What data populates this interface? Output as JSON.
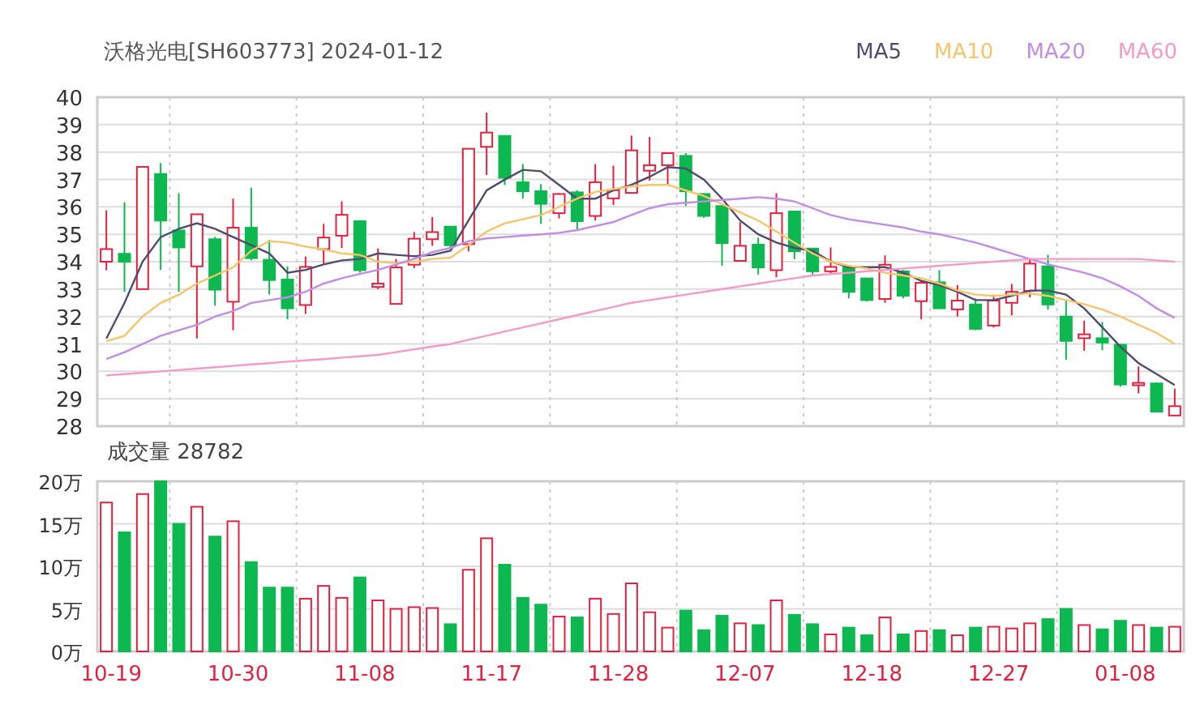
{
  "title": "沃格光电[SH603773] 2024-01-12",
  "price_chart": {
    "chart_data": {
      "type": "candlestick",
      "grid": true,
      "ylim": [
        28,
        40
      ],
      "yticks": [
        28,
        29,
        30,
        31,
        32,
        33,
        34,
        35,
        36,
        37,
        38,
        39,
        40
      ],
      "categories": [
        null,
        null,
        null,
        null,
        null,
        null,
        null,
        null,
        null,
        null,
        null,
        null,
        null,
        null,
        null,
        null,
        null,
        null,
        null,
        null,
        null,
        null,
        null,
        null,
        null,
        null,
        null,
        null,
        null,
        null,
        null,
        null,
        null,
        null,
        null,
        null,
        null,
        null,
        null,
        null,
        null,
        null,
        null,
        null,
        null,
        null,
        null,
        null,
        null,
        null,
        null,
        null,
        null,
        null,
        null,
        null,
        null,
        null,
        null,
        null
      ],
      "ohlc": [
        [
          34.0,
          35.87,
          33.69,
          34.46
        ],
        [
          34.29,
          36.17,
          32.9,
          34.0
        ],
        [
          33.0,
          37.46,
          33.0,
          37.46
        ],
        [
          37.2,
          37.6,
          33.7,
          35.5
        ],
        [
          35.14,
          36.5,
          32.9,
          34.52
        ],
        [
          33.83,
          35.73,
          31.2,
          35.73
        ],
        [
          34.82,
          34.9,
          32.4,
          32.98
        ],
        [
          32.54,
          36.3,
          31.5,
          35.24
        ],
        [
          35.24,
          36.7,
          34.05,
          34.13
        ],
        [
          34.07,
          34.8,
          32.8,
          33.33
        ],
        [
          33.35,
          33.83,
          31.9,
          32.3
        ],
        [
          32.42,
          34.19,
          32.1,
          33.81
        ],
        [
          34.46,
          35.38,
          33.93,
          34.88
        ],
        [
          34.95,
          36.2,
          34.5,
          35.71
        ],
        [
          35.48,
          35.5,
          33.6,
          33.69
        ],
        [
          33.08,
          34.48,
          33.0,
          33.2
        ],
        [
          32.46,
          34.1,
          32.46,
          33.79
        ],
        [
          33.89,
          35.08,
          33.77,
          34.84
        ],
        [
          34.82,
          35.63,
          34.58,
          35.08
        ],
        [
          35.28,
          35.3,
          34.46,
          34.6
        ],
        [
          34.64,
          38.12,
          34.38,
          38.12
        ],
        [
          38.19,
          39.44,
          37.16,
          38.71
        ],
        [
          38.59,
          38.6,
          36.8,
          37.06
        ],
        [
          36.9,
          37.56,
          36.3,
          36.57
        ],
        [
          36.57,
          36.83,
          35.38,
          36.11
        ],
        [
          35.77,
          36.5,
          35.58,
          36.47
        ],
        [
          36.53,
          36.6,
          35.18,
          35.48
        ],
        [
          35.67,
          37.56,
          35.5,
          36.9
        ],
        [
          36.31,
          37.5,
          36.07,
          36.61
        ],
        [
          36.51,
          38.6,
          36.5,
          38.06
        ],
        [
          37.32,
          38.55,
          36.96,
          37.52
        ],
        [
          37.52,
          37.96,
          36.8,
          37.96
        ],
        [
          37.86,
          37.96,
          36.03,
          36.57
        ],
        [
          36.47,
          36.5,
          35.6,
          35.67
        ],
        [
          36.03,
          36.05,
          33.85,
          34.68
        ],
        [
          34.03,
          35.44,
          34.03,
          34.58
        ],
        [
          34.62,
          34.88,
          33.53,
          33.79
        ],
        [
          33.69,
          36.5,
          33.43,
          35.77
        ],
        [
          35.83,
          35.83,
          34.09,
          34.38
        ],
        [
          34.48,
          34.5,
          33.53,
          33.65
        ],
        [
          33.65,
          34.52,
          33.53,
          33.81
        ],
        [
          33.81,
          33.85,
          32.66,
          32.9
        ],
        [
          33.39,
          33.4,
          32.55,
          32.6
        ],
        [
          32.64,
          34.23,
          32.5,
          33.89
        ],
        [
          33.65,
          33.7,
          32.66,
          32.76
        ],
        [
          32.56,
          33.29,
          31.9,
          33.23
        ],
        [
          33.25,
          33.69,
          32.3,
          32.3
        ],
        [
          32.26,
          33.15,
          32.0,
          32.58
        ],
        [
          32.44,
          32.66,
          31.5,
          31.55
        ],
        [
          31.67,
          32.8,
          31.6,
          32.58
        ],
        [
          32.5,
          33.19,
          32.04,
          32.9
        ],
        [
          32.94,
          34.09,
          32.7,
          33.93
        ],
        [
          33.83,
          34.25,
          32.26,
          32.44
        ],
        [
          32.0,
          32.6,
          30.42,
          31.11
        ],
        [
          31.21,
          31.85,
          30.75,
          31.35
        ],
        [
          31.21,
          31.8,
          30.77,
          31.05
        ],
        [
          30.97,
          31.0,
          29.44,
          29.52
        ],
        [
          29.52,
          30.18,
          29.2,
          29.58
        ],
        [
          29.56,
          29.6,
          28.53,
          28.53
        ],
        [
          28.39,
          29.37,
          28.39,
          28.73
        ]
      ],
      "series": [
        {
          "name": "MA5",
          "type": "line",
          "color": "#4f4c6e",
          "values": [
            31.2,
            32.5,
            34.0,
            34.9,
            35.2,
            35.4,
            35.2,
            34.9,
            34.6,
            34.3,
            33.6,
            33.7,
            33.9,
            34.05,
            34.1,
            34.3,
            34.25,
            34.2,
            34.25,
            34.4,
            35.5,
            36.6,
            37.0,
            37.35,
            37.3,
            36.8,
            36.3,
            36.3,
            36.6,
            36.8,
            37.1,
            37.45,
            37.4,
            37.0,
            36.3,
            35.5,
            35.0,
            34.7,
            34.5,
            34.4,
            34.0,
            33.8,
            33.8,
            33.8,
            33.6,
            33.3,
            33.15,
            32.9,
            32.6,
            32.6,
            32.75,
            32.95,
            32.95,
            32.8,
            32.3,
            31.6,
            30.9,
            30.3,
            29.9,
            29.5
          ]
        },
        {
          "name": "MA10",
          "type": "line",
          "color": "#f7c46a",
          "values": [
            31.1,
            31.3,
            32.0,
            32.5,
            32.8,
            33.2,
            33.5,
            33.8,
            34.4,
            34.75,
            34.7,
            34.55,
            34.45,
            34.3,
            34.25,
            34.0,
            33.95,
            34.0,
            34.1,
            34.15,
            34.6,
            35.1,
            35.4,
            35.55,
            35.7,
            36.0,
            36.3,
            36.55,
            36.65,
            36.75,
            36.8,
            36.8,
            36.6,
            36.4,
            36.1,
            35.8,
            35.5,
            35.1,
            34.7,
            34.3,
            34.0,
            33.85,
            33.75,
            33.6,
            33.5,
            33.4,
            33.2,
            32.95,
            32.8,
            32.75,
            32.8,
            32.85,
            32.75,
            32.6,
            32.45,
            32.25,
            32.0,
            31.7,
            31.4,
            31.0
          ]
        },
        {
          "name": "MA20",
          "type": "line",
          "color": "#c38ce6",
          "values": [
            30.45,
            30.7,
            31.0,
            31.3,
            31.5,
            31.7,
            32.0,
            32.2,
            32.5,
            32.6,
            32.7,
            32.9,
            33.2,
            33.4,
            33.55,
            33.7,
            33.9,
            34.1,
            34.35,
            34.5,
            34.75,
            34.85,
            34.9,
            34.95,
            35.0,
            35.05,
            35.15,
            35.3,
            35.45,
            35.7,
            35.95,
            36.1,
            36.15,
            36.2,
            36.25,
            36.3,
            36.35,
            36.3,
            36.2,
            35.95,
            35.7,
            35.55,
            35.45,
            35.35,
            35.25,
            35.1,
            35.0,
            34.85,
            34.7,
            34.5,
            34.3,
            34.1,
            33.9,
            33.75,
            33.6,
            33.4,
            33.1,
            32.75,
            32.3,
            31.95
          ]
        },
        {
          "name": "MA60",
          "type": "line",
          "color": "#f59ac8",
          "values": [
            29.85,
            29.9,
            29.95,
            30.0,
            30.05,
            30.1,
            30.15,
            30.2,
            30.25,
            30.3,
            30.35,
            30.4,
            30.45,
            30.5,
            30.55,
            30.6,
            30.7,
            30.8,
            30.9,
            31.0,
            31.15,
            31.3,
            31.45,
            31.6,
            31.75,
            31.9,
            32.05,
            32.2,
            32.35,
            32.5,
            32.6,
            32.7,
            32.8,
            32.9,
            33.0,
            33.1,
            33.2,
            33.3,
            33.4,
            33.5,
            33.55,
            33.6,
            33.65,
            33.7,
            33.75,
            33.8,
            33.85,
            33.9,
            33.95,
            34.0,
            34.05,
            34.1,
            34.1,
            34.1,
            34.1,
            34.1,
            34.1,
            34.1,
            34.05,
            34.0
          ]
        }
      ]
    }
  },
  "volume": {
    "label": "成交量 28782",
    "chart_data": {
      "type": "bar",
      "grid": true,
      "ylim": [
        0,
        20
      ],
      "yticks": [
        {
          "value": 0,
          "label": "0万"
        },
        {
          "value": 5,
          "label": "5万"
        },
        {
          "value": 10,
          "label": "10万"
        },
        {
          "value": 15,
          "label": "15万"
        },
        {
          "value": 20,
          "label": "20万"
        }
      ],
      "categories": [
        "10-19",
        null,
        null,
        null,
        null,
        null,
        null,
        "10-30",
        null,
        null,
        null,
        null,
        null,
        null,
        "11-08",
        null,
        null,
        null,
        null,
        null,
        null,
        "11-17",
        null,
        null,
        null,
        null,
        null,
        null,
        "11-28",
        null,
        null,
        null,
        null,
        null,
        null,
        "12-07",
        null,
        null,
        null,
        null,
        null,
        null,
        "12-18",
        null,
        null,
        null,
        null,
        null,
        null,
        "12-27",
        null,
        null,
        null,
        null,
        null,
        null,
        "01-08",
        null,
        null,
        null
      ],
      "values": [
        17.5,
        14,
        18.5,
        20,
        15,
        17,
        13.5,
        15.3,
        10.5,
        7.5,
        7.5,
        6.2,
        7.7,
        6.3,
        8.7,
        6,
        5,
        5.2,
        5.1,
        3.2,
        9.6,
        13.3,
        10.2,
        6.3,
        5.5,
        4.1,
        4,
        6.2,
        4.4,
        8,
        4.6,
        2.8,
        4.8,
        2.5,
        4.2,
        3.3,
        3.1,
        6,
        4.3,
        3.2,
        2,
        2.8,
        1.9,
        4,
        2,
        2.4,
        2.5,
        1.9,
        2.8,
        2.9,
        2.7,
        3.3,
        3.8,
        5,
        3.1,
        2.6,
        3.6,
        3.1,
        2.8,
        2.9
      ]
    }
  }
}
